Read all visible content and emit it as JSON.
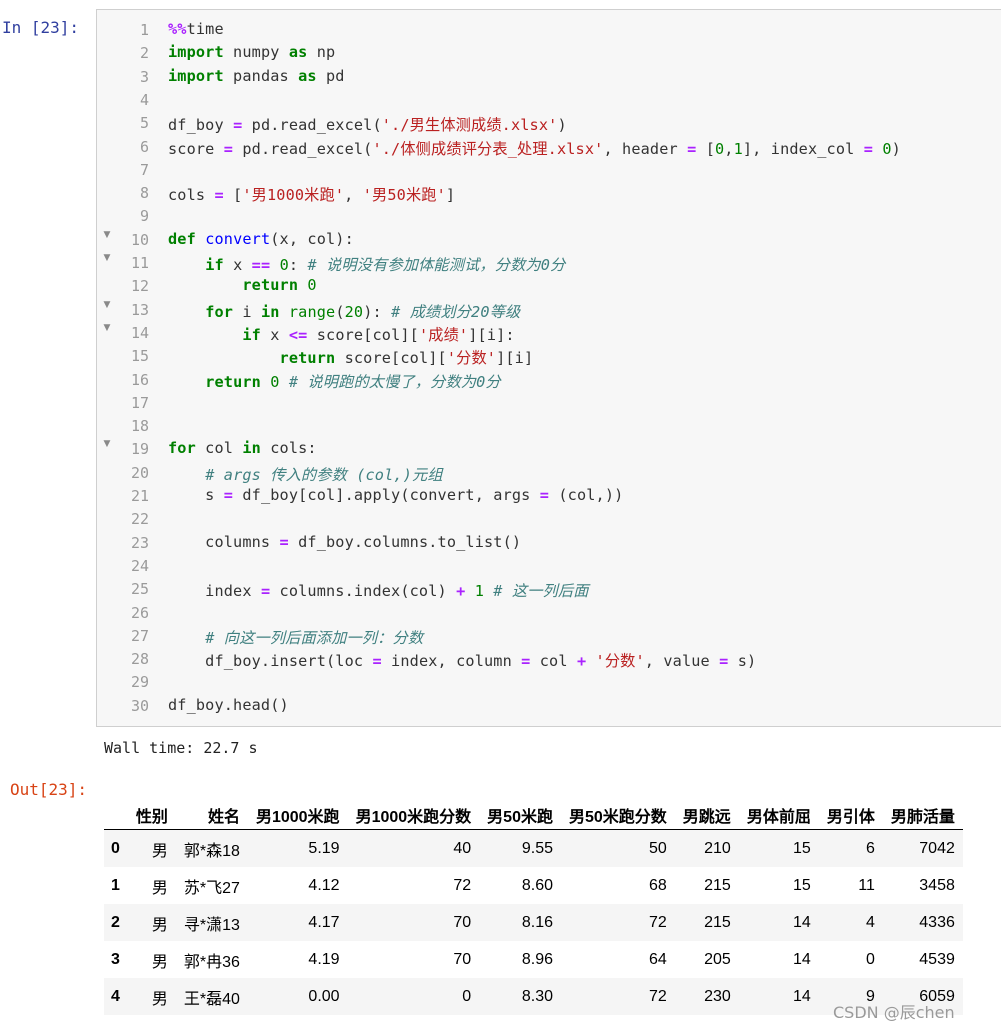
{
  "cell": {
    "in_prompt": "In  [23]:",
    "out_prompt": "Out[23]:",
    "code_lines": [
      {
        "num": "1",
        "fold": false,
        "tokens": [
          {
            "t": "%%",
            "c": "magic"
          },
          {
            "t": "time",
            "c": "txt"
          }
        ]
      },
      {
        "num": "2",
        "fold": false,
        "tokens": [
          {
            "t": "import",
            "c": "kw"
          },
          {
            "t": " numpy ",
            "c": "txt"
          },
          {
            "t": "as",
            "c": "kw"
          },
          {
            "t": " np",
            "c": "txt"
          }
        ]
      },
      {
        "num": "3",
        "fold": false,
        "tokens": [
          {
            "t": "import",
            "c": "kw"
          },
          {
            "t": " pandas ",
            "c": "txt"
          },
          {
            "t": "as",
            "c": "kw"
          },
          {
            "t": " pd",
            "c": "txt"
          }
        ]
      },
      {
        "num": "4",
        "fold": false,
        "tokens": []
      },
      {
        "num": "5",
        "fold": false,
        "tokens": [
          {
            "t": "df_boy ",
            "c": "txt"
          },
          {
            "t": "=",
            "c": "op"
          },
          {
            "t": " pd.read_excel(",
            "c": "txt"
          },
          {
            "t": "'./男生体测成绩.xlsx'",
            "c": "str"
          },
          {
            "t": ")",
            "c": "txt"
          }
        ]
      },
      {
        "num": "6",
        "fold": false,
        "tokens": [
          {
            "t": "score ",
            "c": "txt"
          },
          {
            "t": "=",
            "c": "op"
          },
          {
            "t": " pd.read_excel(",
            "c": "txt"
          },
          {
            "t": "'./体侧成绩评分表_处理.xlsx'",
            "c": "str"
          },
          {
            "t": ", header ",
            "c": "txt"
          },
          {
            "t": "=",
            "c": "op"
          },
          {
            "t": " [",
            "c": "txt"
          },
          {
            "t": "0",
            "c": "num"
          },
          {
            "t": ",",
            "c": "txt"
          },
          {
            "t": "1",
            "c": "num"
          },
          {
            "t": "], index_col ",
            "c": "txt"
          },
          {
            "t": "=",
            "c": "op"
          },
          {
            "t": " ",
            "c": "txt"
          },
          {
            "t": "0",
            "c": "num"
          },
          {
            "t": ")",
            "c": "txt"
          }
        ]
      },
      {
        "num": "7",
        "fold": false,
        "tokens": []
      },
      {
        "num": "8",
        "fold": false,
        "tokens": [
          {
            "t": "cols ",
            "c": "txt"
          },
          {
            "t": "=",
            "c": "op"
          },
          {
            "t": " [",
            "c": "txt"
          },
          {
            "t": "'男1000米跑'",
            "c": "str"
          },
          {
            "t": ", ",
            "c": "txt"
          },
          {
            "t": "'男50米跑'",
            "c": "str"
          },
          {
            "t": "]",
            "c": "txt"
          }
        ]
      },
      {
        "num": "9",
        "fold": false,
        "tokens": []
      },
      {
        "num": "10",
        "fold": true,
        "tokens": [
          {
            "t": "def",
            "c": "kw"
          },
          {
            "t": " ",
            "c": "txt"
          },
          {
            "t": "convert",
            "c": "def"
          },
          {
            "t": "(x, col):",
            "c": "txt"
          }
        ]
      },
      {
        "num": "11",
        "fold": true,
        "tokens": [
          {
            "t": "    ",
            "c": "txt"
          },
          {
            "t": "if",
            "c": "kw"
          },
          {
            "t": " x ",
            "c": "txt"
          },
          {
            "t": "==",
            "c": "op"
          },
          {
            "t": " ",
            "c": "txt"
          },
          {
            "t": "0",
            "c": "num"
          },
          {
            "t": ": ",
            "c": "txt"
          },
          {
            "t": "# 说明没有参加体能测试，分数为0分",
            "c": "com"
          }
        ]
      },
      {
        "num": "12",
        "fold": false,
        "tokens": [
          {
            "t": "        ",
            "c": "txt"
          },
          {
            "t": "return",
            "c": "kw"
          },
          {
            "t": " ",
            "c": "txt"
          },
          {
            "t": "0",
            "c": "num"
          }
        ]
      },
      {
        "num": "13",
        "fold": true,
        "tokens": [
          {
            "t": "    ",
            "c": "txt"
          },
          {
            "t": "for",
            "c": "kw"
          },
          {
            "t": " i ",
            "c": "txt"
          },
          {
            "t": "in",
            "c": "kw"
          },
          {
            "t": " ",
            "c": "txt"
          },
          {
            "t": "range",
            "c": "bi"
          },
          {
            "t": "(",
            "c": "txt"
          },
          {
            "t": "20",
            "c": "num"
          },
          {
            "t": "): ",
            "c": "txt"
          },
          {
            "t": "# 成绩划分20等级",
            "c": "com"
          }
        ]
      },
      {
        "num": "14",
        "fold": true,
        "tokens": [
          {
            "t": "        ",
            "c": "txt"
          },
          {
            "t": "if",
            "c": "kw"
          },
          {
            "t": " x ",
            "c": "txt"
          },
          {
            "t": "<=",
            "c": "op"
          },
          {
            "t": " score[col][",
            "c": "txt"
          },
          {
            "t": "'成绩'",
            "c": "str"
          },
          {
            "t": "][i]:",
            "c": "txt"
          }
        ]
      },
      {
        "num": "15",
        "fold": false,
        "tokens": [
          {
            "t": "            ",
            "c": "txt"
          },
          {
            "t": "return",
            "c": "kw"
          },
          {
            "t": " score[col][",
            "c": "txt"
          },
          {
            "t": "'分数'",
            "c": "str"
          },
          {
            "t": "][i]",
            "c": "txt"
          }
        ]
      },
      {
        "num": "16",
        "fold": false,
        "tokens": [
          {
            "t": "    ",
            "c": "txt"
          },
          {
            "t": "return",
            "c": "kw"
          },
          {
            "t": " ",
            "c": "txt"
          },
          {
            "t": "0",
            "c": "num"
          },
          {
            "t": " ",
            "c": "txt"
          },
          {
            "t": "# 说明跑的太慢了，分数为0分",
            "c": "com"
          }
        ]
      },
      {
        "num": "17",
        "fold": false,
        "tokens": []
      },
      {
        "num": "18",
        "fold": false,
        "tokens": []
      },
      {
        "num": "19",
        "fold": true,
        "tokens": [
          {
            "t": "for",
            "c": "kw"
          },
          {
            "t": " col ",
            "c": "txt"
          },
          {
            "t": "in",
            "c": "kw"
          },
          {
            "t": " cols:",
            "c": "txt"
          }
        ]
      },
      {
        "num": "20",
        "fold": false,
        "tokens": [
          {
            "t": "    ",
            "c": "txt"
          },
          {
            "t": "# args 传入的参数 (col,)元组",
            "c": "com"
          }
        ]
      },
      {
        "num": "21",
        "fold": false,
        "tokens": [
          {
            "t": "    s ",
            "c": "txt"
          },
          {
            "t": "=",
            "c": "op"
          },
          {
            "t": " df_boy[col].apply(convert, args ",
            "c": "txt"
          },
          {
            "t": "=",
            "c": "op"
          },
          {
            "t": " (col,))",
            "c": "txt"
          }
        ]
      },
      {
        "num": "22",
        "fold": false,
        "tokens": []
      },
      {
        "num": "23",
        "fold": false,
        "tokens": [
          {
            "t": "    columns ",
            "c": "txt"
          },
          {
            "t": "=",
            "c": "op"
          },
          {
            "t": " df_boy.columns.to_list()",
            "c": "txt"
          }
        ]
      },
      {
        "num": "24",
        "fold": false,
        "tokens": []
      },
      {
        "num": "25",
        "fold": false,
        "tokens": [
          {
            "t": "    index ",
            "c": "txt"
          },
          {
            "t": "=",
            "c": "op"
          },
          {
            "t": " columns.index(col) ",
            "c": "txt"
          },
          {
            "t": "+",
            "c": "op"
          },
          {
            "t": " ",
            "c": "txt"
          },
          {
            "t": "1",
            "c": "num"
          },
          {
            "t": " ",
            "c": "txt"
          },
          {
            "t": "# 这一列后面",
            "c": "com"
          }
        ]
      },
      {
        "num": "26",
        "fold": false,
        "tokens": []
      },
      {
        "num": "27",
        "fold": false,
        "tokens": [
          {
            "t": "    ",
            "c": "txt"
          },
          {
            "t": "# 向这一列后面添加一列：分数",
            "c": "com"
          }
        ]
      },
      {
        "num": "28",
        "fold": false,
        "tokens": [
          {
            "t": "    df_boy.insert(loc ",
            "c": "txt"
          },
          {
            "t": "=",
            "c": "op"
          },
          {
            "t": " index, column ",
            "c": "txt"
          },
          {
            "t": "=",
            "c": "op"
          },
          {
            "t": " col ",
            "c": "txt"
          },
          {
            "t": "+",
            "c": "op"
          },
          {
            "t": " ",
            "c": "txt"
          },
          {
            "t": "'分数'",
            "c": "str"
          },
          {
            "t": ", value ",
            "c": "txt"
          },
          {
            "t": "=",
            "c": "op"
          },
          {
            "t": " s)",
            "c": "txt"
          }
        ]
      },
      {
        "num": "29",
        "fold": false,
        "tokens": []
      },
      {
        "num": "30",
        "fold": false,
        "tokens": [
          {
            "t": "df_boy.head()",
            "c": "txt"
          }
        ]
      }
    ]
  },
  "output": {
    "wall_time": "Wall time: 22.7 s",
    "table": {
      "columns": [
        "",
        "性别",
        "姓名",
        "男1000米跑",
        "男1000米跑分数",
        "男50米跑",
        "男50米跑分数",
        "男跳远",
        "男体前屈",
        "男引体",
        "男肺活量"
      ],
      "rows": [
        [
          "0",
          "男",
          "郭*森18",
          "5.19",
          "40",
          "9.55",
          "50",
          "210",
          "15",
          "6",
          "7042"
        ],
        [
          "1",
          "男",
          "苏*飞27",
          "4.12",
          "72",
          "8.60",
          "68",
          "215",
          "15",
          "11",
          "3458"
        ],
        [
          "2",
          "男",
          "寻*潇13",
          "4.17",
          "70",
          "8.16",
          "72",
          "215",
          "14",
          "4",
          "4336"
        ],
        [
          "3",
          "男",
          "郭*冉36",
          "4.19",
          "70",
          "8.96",
          "64",
          "205",
          "14",
          "0",
          "4539"
        ],
        [
          "4",
          "男",
          "王*磊40",
          "0.00",
          "0",
          "8.30",
          "72",
          "230",
          "14",
          "9",
          "6059"
        ]
      ]
    }
  },
  "watermark": "CSDN @辰chen"
}
